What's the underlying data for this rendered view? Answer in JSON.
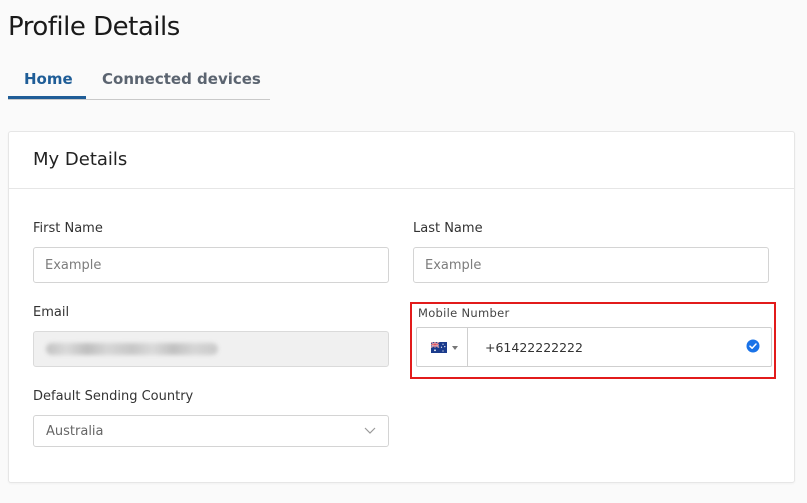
{
  "page": {
    "title": "Profile Details"
  },
  "tabs": [
    {
      "label": "Home",
      "active": true
    },
    {
      "label": "Connected devices",
      "active": false
    }
  ],
  "card": {
    "title": "My Details",
    "fields": {
      "first_name": {
        "label": "First Name",
        "placeholder": "Example"
      },
      "last_name": {
        "label": "Last Name",
        "placeholder": "Example"
      },
      "email": {
        "label": "Email"
      },
      "mobile": {
        "label": "Mobile Number",
        "value": "+61422222222",
        "country_flag": "australia-flag-icon",
        "verified_icon": "check-circle-icon"
      },
      "country": {
        "label": "Default Sending Country",
        "value": "Australia"
      }
    }
  },
  "colors": {
    "accent": "#1f5d97",
    "highlight": "#e21b1b",
    "verified": "#1a73e8"
  }
}
